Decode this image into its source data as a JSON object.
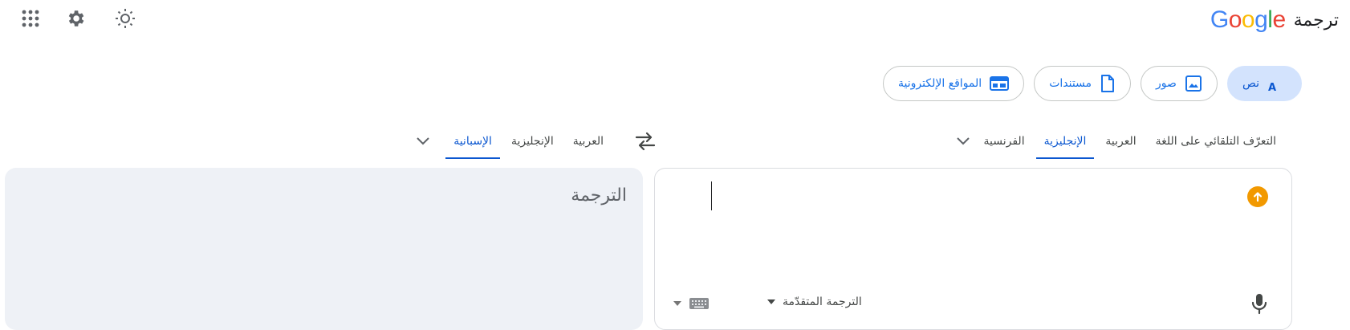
{
  "header": {
    "title": "ترجمة",
    "logo_text": "Google",
    "logo_colors": [
      "#4285F4",
      "#EA4335",
      "#FBBC05",
      "#4285F4",
      "#34A853",
      "#EA4335"
    ],
    "icons": [
      "apps-grid-icon",
      "settings-gear-icon",
      "theme-sun-icon"
    ]
  },
  "modes": [
    {
      "label": "نص",
      "icon": "translate-icon",
      "active": true
    },
    {
      "label": "صور",
      "icon": "image-icon",
      "active": false
    },
    {
      "label": "مستندات",
      "icon": "document-icon",
      "active": false
    },
    {
      "label": "المواقع الإلكترونية",
      "icon": "website-icon",
      "active": false
    }
  ],
  "source": {
    "languages": [
      "التعرّف التلقائي على اللغة",
      "العربية",
      "الإنجليزية",
      "الفرنسية"
    ],
    "selected": "الإنجليزية",
    "advanced_label": "الترجمة المتقدّمة",
    "accent_upload": "#f29900"
  },
  "target": {
    "languages": [
      "العربية",
      "الإنجليزية",
      "الإسبانية"
    ],
    "selected": "الإسبانية",
    "placeholder": "الترجمة"
  },
  "colors": {
    "accent": "#0b57d0",
    "chip_active_bg": "#d3e3fd",
    "target_bg": "#eef1f6"
  }
}
